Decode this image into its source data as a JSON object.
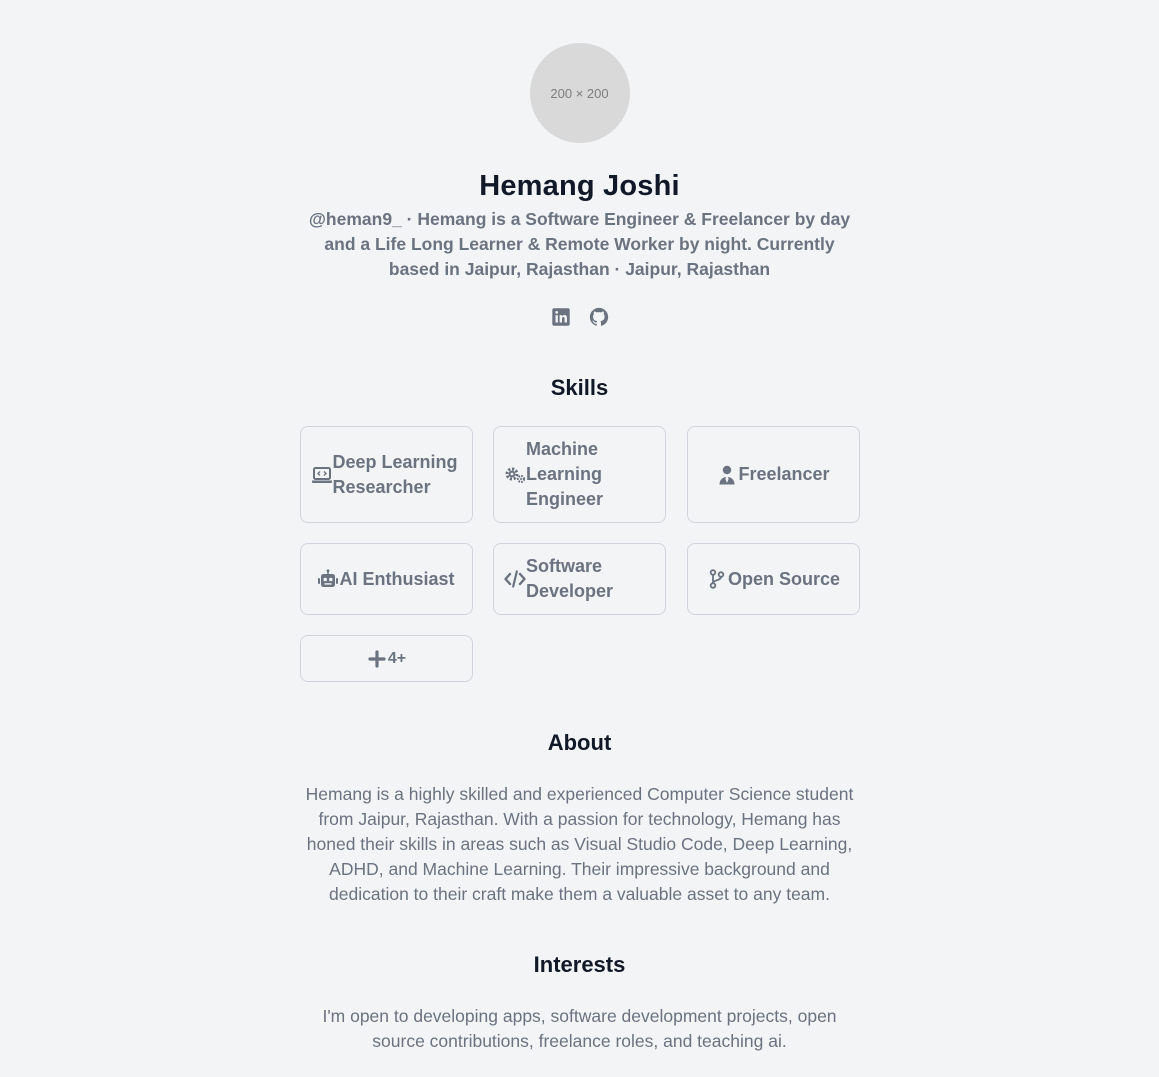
{
  "profile": {
    "avatar_placeholder": "200 × 200",
    "name": "Hemang Joshi",
    "tagline": "@heman9_ · Hemang is a Software Engineer & Freelancer by day and a Life Long Learner & Remote Worker by night. Currently based in Jaipur, Rajasthan · Jaipur, Rajasthan"
  },
  "socials": [
    {
      "icon": "linkedin-icon"
    },
    {
      "icon": "github-icon"
    }
  ],
  "skills": {
    "title": "Skills",
    "items": [
      {
        "label": "Deep Learning Researcher",
        "icon": "laptop-code-icon"
      },
      {
        "label": "Machine Learning Engineer",
        "icon": "gears-icon"
      },
      {
        "label": "Freelancer",
        "icon": "user-tie-icon"
      },
      {
        "label": "AI Enthusiast",
        "icon": "robot-icon"
      },
      {
        "label": "Software Developer",
        "icon": "code-icon"
      },
      {
        "label": "Open Source",
        "icon": "code-branch-icon"
      }
    ],
    "more_label": "4+",
    "more_icon": "plus-icon"
  },
  "about": {
    "title": "About",
    "text": "Hemang is a highly skilled and experienced Computer Science student from Jaipur, Rajasthan. With a passion for technology, Hemang has honed their skills in areas such as Visual Studio Code, Deep Learning, ADHD, and Machine Learning. Their impressive background and dedication to their craft make them a valuable asset to any team."
  },
  "interests": {
    "title": "Interests",
    "text": "I'm open to developing apps, software development projects, open source contributions, freelance roles, and teaching ai."
  },
  "colors": {
    "background": "#f3f4f6",
    "heading": "#111827",
    "text": "#6b7280",
    "border": "#d1d5db",
    "avatar": "#d9d9d9"
  }
}
